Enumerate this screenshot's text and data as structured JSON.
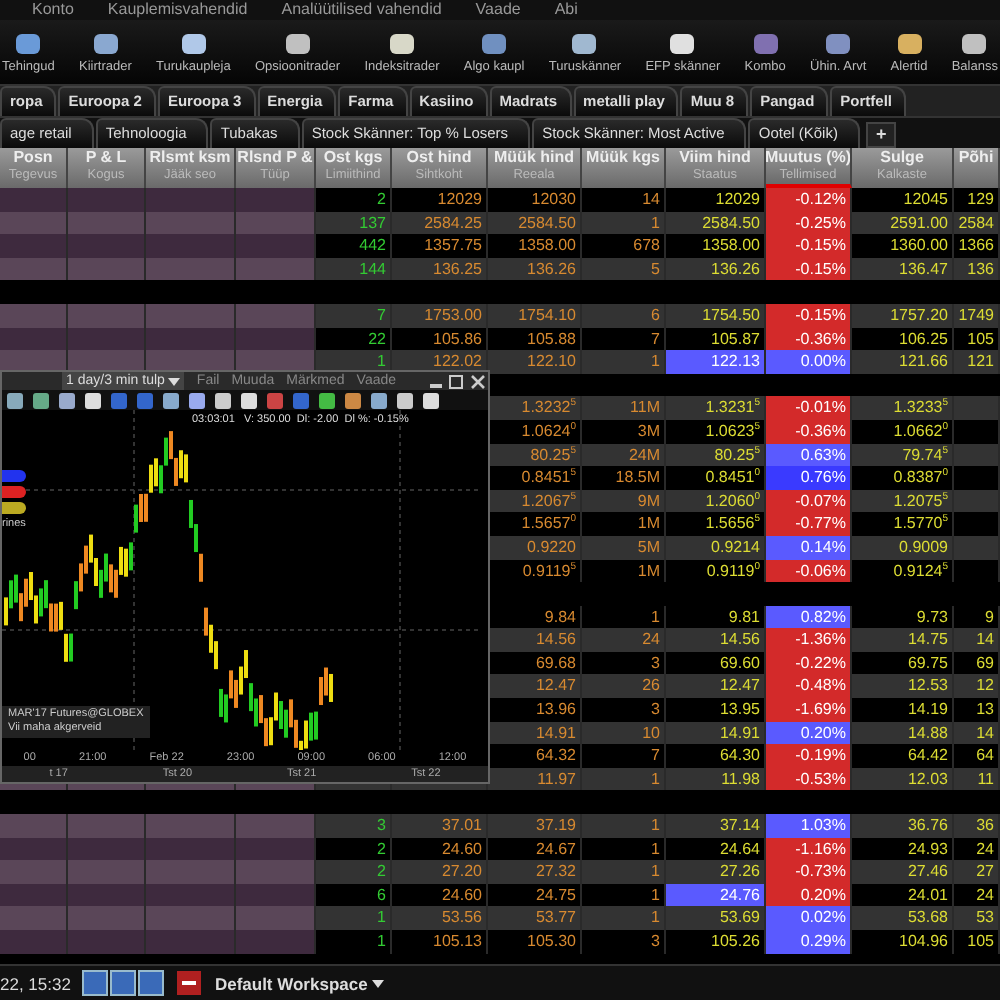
{
  "menu": [
    "Konto",
    "Kauplemisvahendid",
    "Analüütilised vahendid",
    "Vaade",
    "Abi"
  ],
  "toolbar": [
    "Tehingud",
    "Kiirtrader",
    "Turukaupleja",
    "Opsioonitrader",
    "Indeksitrader",
    "Algo kaupl",
    "Turuskänner",
    "EFP skänner",
    "Kombo",
    "Ühin. Arvt",
    "Alertid",
    "Balanss"
  ],
  "tabs_top": [
    "ropa",
    "Euroopa 2",
    "Euroopa 3",
    "Energia",
    "Farma",
    "Kasiino",
    "Madrats",
    "metalli play",
    "Muu 8",
    "Pangad",
    "Portfell"
  ],
  "tabs_bottom": [
    "age retail",
    "Tehnoloogia",
    "Tubakas",
    "Stock Skänner: Top % Losers",
    "Stock Skänner: Most Active",
    "Ootel (Kõik)"
  ],
  "add_tab": "+",
  "columns": [
    {
      "title": "Posn",
      "subtitle": "Tegevus",
      "sorted": false
    },
    {
      "title": "P & L",
      "subtitle": "Kogus",
      "sorted": false
    },
    {
      "title": "Rlsmt ksm",
      "subtitle": "Jääk seo",
      "sorted": false
    },
    {
      "title": "Rlsnd P &",
      "subtitle": "Tüüp",
      "sorted": false
    },
    {
      "title": "Ost kgs",
      "subtitle": "Limiithind",
      "sorted": false
    },
    {
      "title": "Ost hind",
      "subtitle": "Sihtkoht",
      "sorted": false
    },
    {
      "title": "Müük hind",
      "subtitle": "Reeala",
      "sorted": false
    },
    {
      "title": "Müük kgs",
      "sorted": false
    },
    {
      "title": "Viim hind",
      "subtitle": "Staatus",
      "sorted": false
    },
    {
      "title": "Muutus (%)",
      "subtitle": "Tellimised",
      "sorted": true
    },
    {
      "title": "Sulge",
      "subtitle": "Kalkaste",
      "sorted": false
    },
    {
      "title": "Põhi",
      "sorted": false
    }
  ],
  "rows": [
    {
      "kind": "quote",
      "bid_size": "2",
      "bid": "12029",
      "ask": "12030",
      "ask_size": "14",
      "last": "12029",
      "last_highlight": false,
      "change": "-0.12%",
      "color": "#d32a2a",
      "close": "12045",
      "base": "129"
    },
    {
      "kind": "quote",
      "bid_size": "137",
      "bid": "2584.25",
      "ask": "2584.50",
      "ask_size": "1",
      "last": "2584.50",
      "last_highlight": false,
      "change": "-0.25%",
      "color": "#d32a2a",
      "close": "2591.00",
      "base": "2584"
    },
    {
      "kind": "quote",
      "bid_size": "442",
      "bid": "1357.75",
      "ask": "1358.00",
      "ask_size": "678",
      "last": "1358.00",
      "last_highlight": false,
      "change": "-0.15%",
      "color": "#d32a2a",
      "close": "1360.00",
      "base": "1366"
    },
    {
      "kind": "quote",
      "bid_size": "144",
      "bid": "136.25",
      "ask": "136.26",
      "ask_size": "5",
      "last": "136.26",
      "last_highlight": false,
      "change": "-0.15%",
      "color": "#d32a2a",
      "close": "136.47",
      "base": "136"
    },
    {
      "kind": "spacer"
    },
    {
      "kind": "quote",
      "bid_size": "7",
      "bid": "1753.00",
      "ask": "1754.10",
      "ask_size": "6",
      "last": "1754.50",
      "last_highlight": false,
      "change": "-0.15%",
      "color": "#d32a2a",
      "close": "1757.20",
      "base": "1749"
    },
    {
      "kind": "quote",
      "bid_size": "22",
      "bid": "105.86",
      "ask": "105.88",
      "ask_size": "7",
      "last": "105.87",
      "last_highlight": false,
      "change": "-0.36%",
      "color": "#d32a2a",
      "close": "106.25",
      "base": "105"
    },
    {
      "kind": "quote",
      "bid_size": "1",
      "bid": "122.02",
      "ask": "122.10",
      "ask_size": "1",
      "last": "122.13",
      "last_highlight": true,
      "change": "0.00%",
      "color": "#5a5aff",
      "close": "121.66",
      "base": "121"
    },
    {
      "kind": "spacer"
    },
    {
      "kind": "quote",
      "ask": "1.3232$^{5}$",
      "ask_size": "11M",
      "last": "1.3231$^{5}$",
      "last_highlight": false,
      "change": "-0.01%",
      "color": "#d32a2a",
      "close": "1.3233$^{5}$"
    },
    {
      "kind": "quote",
      "ask": "1.0624$^{0}$",
      "ask_size": "3M",
      "last": "1.0623$^{5}$",
      "last_highlight": false,
      "change": "-0.36%",
      "color": "#d32a2a",
      "close": "1.0662$^{0}$"
    },
    {
      "kind": "quote",
      "ask": "80.25$^{5}$",
      "ask_size": "24M",
      "last": "80.25$^{5}$",
      "last_highlight": false,
      "change": "0.63%",
      "color": "#5a5aff",
      "close": "79.74$^{5}$"
    },
    {
      "kind": "quote",
      "ask": "0.8451$^{5}$",
      "ask_size": "18.5M",
      "last": "0.8451$^{0}$",
      "last_highlight": false,
      "change": "0.76%",
      "color": "#3a3aff",
      "close": "0.8387$^{0}$"
    },
    {
      "kind": "quote",
      "ask": "1.2067$^{5}$",
      "ask_size": "9M",
      "last": "1.2060$^{0}$",
      "last_highlight": false,
      "change": "-0.07%",
      "color": "#d32a2a",
      "close": "1.2075$^{5}$"
    },
    {
      "kind": "quote",
      "ask": "1.5657$^{0}$",
      "ask_size": "1M",
      "last": "1.5656$^{5}$",
      "last_highlight": false,
      "change": "-0.77%",
      "color": "#d32a2a",
      "close": "1.5770$^{5}$"
    },
    {
      "kind": "quote",
      "ask": "0.9220",
      "ask_size": "5M",
      "last": "0.9214",
      "last_highlight": false,
      "change": "0.14%",
      "color": "#5a5aff",
      "close": "0.9009"
    },
    {
      "kind": "quote",
      "ask": "0.9119$^{5}$",
      "ask_size": "1M",
      "last": "0.9119$^{0}$",
      "last_highlight": false,
      "change": "-0.06%",
      "color": "#d32a2a",
      "close": "0.9124$^{5}$"
    },
    {
      "kind": "spacer"
    },
    {
      "kind": "quote",
      "ask": "9.84",
      "ask_size": "1",
      "last": "9.81",
      "last_highlight": false,
      "change": "0.82%",
      "color": "#5a5aff",
      "close": "9.73",
      "base": "9"
    },
    {
      "kind": "quote",
      "ask": "14.56",
      "ask_size": "24",
      "last": "14.56",
      "last_highlight": false,
      "change": "-1.36%",
      "color": "#d32a2a",
      "close": "14.75",
      "base": "14"
    },
    {
      "kind": "quote",
      "ask": "69.68",
      "ask_size": "3",
      "last": "69.60",
      "last_highlight": false,
      "change": "-0.22%",
      "color": "#d32a2a",
      "close": "69.75",
      "base": "69"
    },
    {
      "kind": "quote",
      "ask": "12.47",
      "ask_size": "26",
      "last": "12.47",
      "last_highlight": false,
      "change": "-0.48%",
      "color": "#d32a2a",
      "close": "12.53",
      "base": "12"
    },
    {
      "kind": "quote",
      "ask": "13.96",
      "ask_size": "3",
      "last": "13.95",
      "last_highlight": false,
      "change": "-1.69%",
      "color": "#d32a2a",
      "close": "14.19",
      "base": "13"
    },
    {
      "kind": "quote",
      "ask": "14.91",
      "ask_size": "10",
      "last": "14.91",
      "last_highlight": false,
      "change": "0.20%",
      "color": "#5a5aff",
      "close": "14.88",
      "base": "14"
    },
    {
      "kind": "quote",
      "ask": "64.32",
      "ask_size": "7",
      "last": "64.30",
      "last_highlight": false,
      "change": "-0.19%",
      "color": "#d32a2a",
      "close": "64.42",
      "base": "64"
    },
    {
      "kind": "quote",
      "ask": "11.97",
      "ask_size": "1",
      "last": "11.98",
      "last_highlight": false,
      "change": "-0.53%",
      "color": "#d32a2a",
      "close": "12.03",
      "base": "11"
    },
    {
      "kind": "spacer"
    },
    {
      "kind": "quote",
      "bid_size": "3",
      "bid": "37.01",
      "ask": "37.19",
      "ask_size": "1",
      "last": "37.14",
      "last_highlight": false,
      "change": "1.03%",
      "color": "#5a5aff",
      "close": "36.76",
      "base": "36"
    },
    {
      "kind": "quote",
      "bid_size": "2",
      "bid": "24.60",
      "ask": "24.67",
      "ask_size": "1",
      "last": "24.64",
      "last_highlight": false,
      "change": "-1.16%",
      "color": "#d32a2a",
      "close": "24.93",
      "base": "24"
    },
    {
      "kind": "quote",
      "bid_size": "2",
      "bid": "27.20",
      "ask": "27.32",
      "ask_size": "1",
      "last": "27.26",
      "last_highlight": false,
      "change": "-0.73%",
      "color": "#d32a2a",
      "close": "27.46",
      "base": "27"
    },
    {
      "kind": "quote",
      "bid_size": "6",
      "bid": "24.60",
      "ask": "24.75",
      "ask_size": "1",
      "last": "24.76",
      "last_highlight": true,
      "change": "0.20%",
      "color": "#d32a2a",
      "close": "24.01",
      "base": "24"
    },
    {
      "kind": "quote",
      "bid_size": "1",
      "bid": "53.56",
      "ask": "53.77",
      "ask_size": "1",
      "last": "53.69",
      "last_highlight": false,
      "change": "0.02%",
      "color": "#5a5aff",
      "close": "53.68",
      "base": "53"
    },
    {
      "kind": "quote",
      "bid_size": "1",
      "bid": "105.13",
      "ask": "105.30",
      "ask_size": "3",
      "last": "105.26",
      "last_highlight": false,
      "change": "0.29%",
      "color": "#5a5aff",
      "close": "104.96",
      "base": "105"
    }
  ],
  "chart_window": {
    "period": "1 day/3 min tulp",
    "menu": [
      "Fail",
      "Muuda",
      "Märkmed",
      "Vaade"
    ],
    "readout": "03:03:01   V: 350.00  Dl: -2.00  Dl %: -0.15%",
    "legend": [
      {
        "color": "#2233ee"
      },
      {
        "color": "#dd2222"
      },
      {
        "color": "#bbaa22"
      }
    ],
    "legend_note": "rines",
    "contract": "MAR'17 Futures@GLOBEX",
    "note": "Vii maha akgerveid",
    "times": [
      "00",
      "21:00",
      "Feb 22",
      "23:00",
      "09:00",
      "06:00",
      "12:00"
    ],
    "dates": [
      "t 17",
      "Tst 20",
      "Tst 21",
      "Tst 22"
    ]
  },
  "status_bar": {
    "time": "22, 15:32",
    "workspace": "Default Workspace"
  }
}
